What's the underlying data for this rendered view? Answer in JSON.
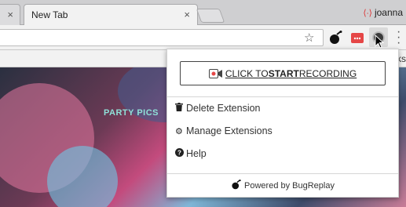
{
  "tabs": {
    "prev_close": "×",
    "active_title": "New Tab",
    "active_close": "×"
  },
  "profile": {
    "name": "joanna",
    "icon": "profile-broken-icon"
  },
  "toolbar": {
    "star": "☆",
    "menu": "⋮"
  },
  "bookmarks": {
    "fragment": "ks"
  },
  "page": {
    "heading": "PARTY PICS"
  },
  "popup": {
    "record_prefix": "CLICK TO ",
    "record_bold": "START",
    "record_suffix": " RECORDING",
    "items": [
      {
        "icon": "trash-icon",
        "label": "Delete Extension"
      },
      {
        "icon": "gear-icon",
        "label": "Manage Extensions"
      },
      {
        "icon": "help-icon",
        "label": "Help"
      }
    ],
    "powered_by": "Powered by BugReplay"
  },
  "colors": {
    "accent_red": "#dd3333",
    "party_text": "#8fe0d8"
  }
}
